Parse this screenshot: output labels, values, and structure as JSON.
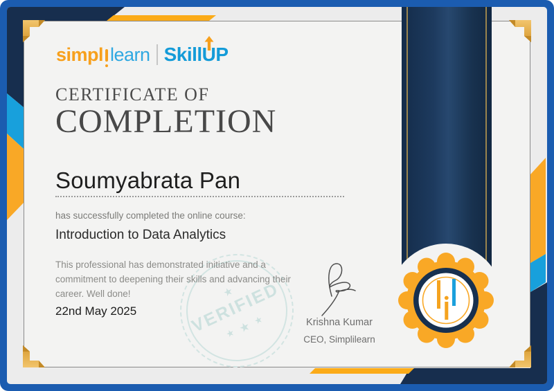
{
  "certificate": {
    "logo": {
      "word1": "simpl",
      "word2": "learn",
      "brand_skill": "Skill",
      "brand_u": "U",
      "brand_p": "P"
    },
    "title_line1": "CERTIFICATE OF",
    "title_line2": "COMPLETION",
    "recipient": "Soumyabrata Pan",
    "subtitle": "has successfully completed the online course:",
    "course": "Introduction to Data Analytics",
    "description": "This professional has demonstrated initiative and a commitment to deepening their skills and advancing their career. Well done!",
    "date": "22nd May 2025",
    "stamp": {
      "text": "VERIFIED",
      "star_top": "★",
      "stars_bottom": [
        "★",
        "★",
        "★"
      ]
    },
    "signature": {
      "name": "Krishna Kumar",
      "title": "CEO, Simplilearn"
    },
    "colors": {
      "frame_blue": "#1B5CB0",
      "navy": "#172E4E",
      "accent_yellow": "#F9A826",
      "accent_teal": "#18A0DC",
      "logo_orange": "#F7A01D",
      "logo_blue": "#2FA8E1",
      "skillup_blue": "#149BD8",
      "stamp_teal": "#CDE1DF"
    }
  }
}
